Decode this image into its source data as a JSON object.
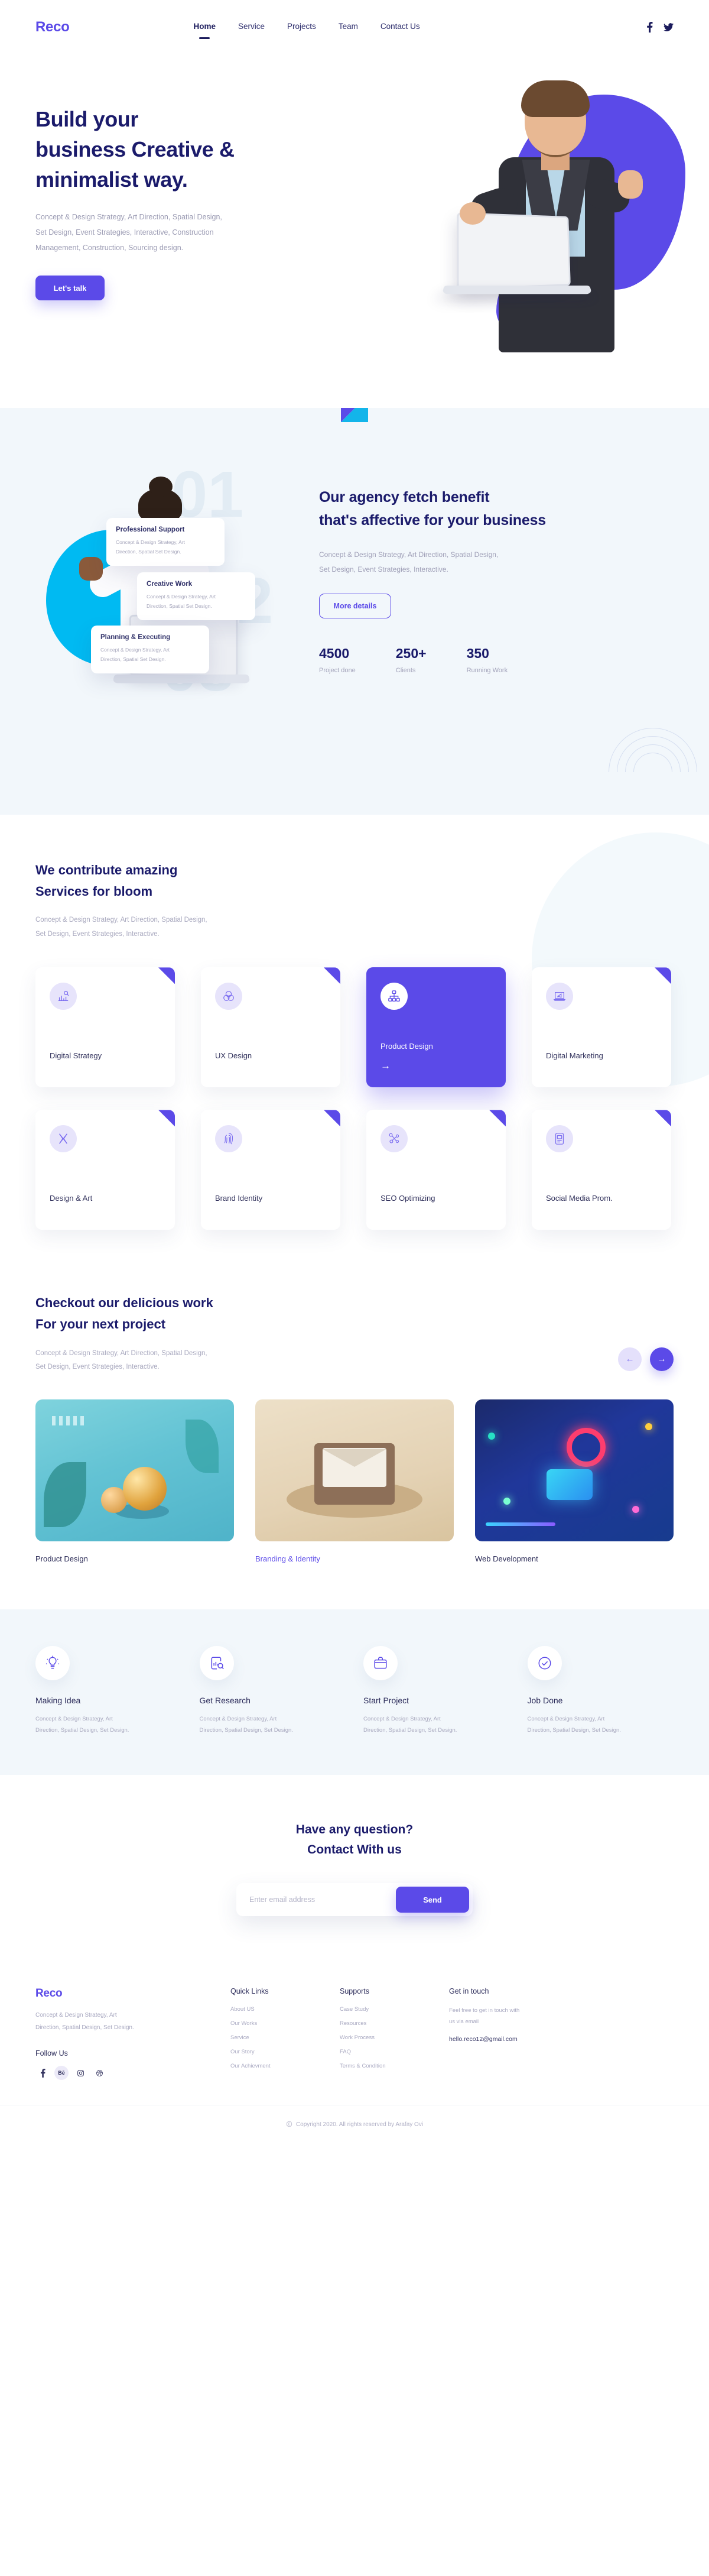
{
  "brand": {
    "name": "Reco",
    "accent": "#5b4ae8",
    "dark": "#1b1b6b",
    "cyan": "#00baf2"
  },
  "header": {
    "nav": [
      {
        "label": "Home",
        "active": true
      },
      {
        "label": "Service",
        "active": false
      },
      {
        "label": "Projects",
        "active": false
      },
      {
        "label": "Team",
        "active": false
      },
      {
        "label": "Contact Us",
        "active": false
      }
    ],
    "social": [
      {
        "name": "facebook-icon",
        "glyph": "f"
      },
      {
        "name": "twitter-icon",
        "glyph": "🐦"
      }
    ]
  },
  "hero": {
    "title_line1": "Build your",
    "title_line2": "business Creative &",
    "title_line3": "minimalist way.",
    "description_line1": "Concept & Design Strategy, Art Direction, Spatial Design,",
    "description_line2": "Set Design, Event Strategies, Interactive, Construction",
    "description_line3": "Management, Construction, Sourcing design.",
    "cta_label": "Let's talk"
  },
  "benefit": {
    "heading_line1": "Our agency fetch benefit",
    "heading_line2": "that's affective for your business",
    "sub_line1": "Concept & Design Strategy, Art Direction, Spatial Design,",
    "sub_line2": "Set Design, Event Strategies, Interactive.",
    "cta_label": "More details",
    "ghost_numbers": [
      "01",
      "02",
      "03"
    ],
    "cards": [
      {
        "title": "Professional Support",
        "line1": "Concept & Design Strategy, Art",
        "line2": "Direction, Spatial Set Design."
      },
      {
        "title": "Creative Work",
        "line1": "Concept & Design Strategy, Art",
        "line2": "Direction, Spatial Set Design."
      },
      {
        "title": "Planning & Executing",
        "line1": "Concept & Design Strategy, Art",
        "line2": "Direction, Spatial Set Design."
      }
    ],
    "stats": [
      {
        "number": "4500",
        "label": "Project done"
      },
      {
        "number": "250+",
        "label": "Clients"
      },
      {
        "number": "350",
        "label": "Running Work"
      }
    ]
  },
  "services": {
    "heading_line1": "We contribute amazing",
    "heading_line2": "Services for bloom",
    "sub_line1": "Concept & Design Strategy, Art Direction, Spatial Design,",
    "sub_line2": "Set Design, Event Strategies, Interactive.",
    "cards": [
      {
        "title": "Digital Strategy",
        "icon": "chart-growth-icon",
        "featured": false
      },
      {
        "title": "UX Design",
        "icon": "venn-circles-icon",
        "featured": false
      },
      {
        "title": "Product Design",
        "icon": "sitemap-icon",
        "featured": true,
        "arrow": "→"
      },
      {
        "title": "Digital Marketing",
        "icon": "megaphone-laptop-icon",
        "featured": false
      },
      {
        "title": "Design & Art",
        "icon": "crossed-ribbons-icon",
        "featured": false
      },
      {
        "title": "Brand Identity",
        "icon": "fingerprint-icon",
        "featured": false
      },
      {
        "title": "SEO Optimizing",
        "icon": "network-nodes-icon",
        "featured": false
      },
      {
        "title": "Social Media Prom.",
        "icon": "mobile-promo-icon",
        "featured": false
      }
    ]
  },
  "work": {
    "heading_line1": "Checkout our delicious work",
    "heading_line2": "For your next project",
    "sub_line1": "Concept & Design Strategy, Art Direction, Spatial Design,",
    "sub_line2": "Set Design, Event Strategies, Interactive.",
    "prev_glyph": "←",
    "next_glyph": "→",
    "items": [
      {
        "label": "Product Design",
        "active": false
      },
      {
        "label": "Branding & Identity",
        "active": true
      },
      {
        "label": "Web Development",
        "active": false
      }
    ]
  },
  "process": {
    "items": [
      {
        "title": "Making Idea",
        "icon": "lightbulb-icon",
        "line1": "Concept & Design Strategy, Art",
        "line2": "Direction, Spatial Design, Set Design."
      },
      {
        "title": "Get Research",
        "icon": "research-chart-icon",
        "line1": "Concept & Design Strategy, Art",
        "line2": "Direction, Spatial Design, Set Design."
      },
      {
        "title": "Start Project",
        "icon": "briefcase-icon",
        "line1": "Concept & Design Strategy, Art",
        "line2": "Direction, Spatial Design, Set Design."
      },
      {
        "title": "Job Done",
        "icon": "check-circle-icon",
        "line1": "Concept & Design Strategy, Art",
        "line2": "Direction, Spatial Design, Set Design."
      }
    ]
  },
  "contact": {
    "heading_line1": "Have any question?",
    "heading_line2": "Contact With us",
    "email_placeholder": "Enter email address",
    "email_value": "",
    "send_label": "Send"
  },
  "footer": {
    "brand": "Reco",
    "about_line1": "Concept & Design Strategy, Art",
    "about_line2": "Direction, Spatial Design, Set Design.",
    "follow_label": "Follow Us",
    "socials": [
      {
        "name": "facebook-icon",
        "glyph": "f",
        "chip": false
      },
      {
        "name": "behance-icon",
        "glyph": "Bē",
        "chip": true
      },
      {
        "name": "instagram-icon",
        "glyph": "▢",
        "chip": false
      },
      {
        "name": "dribbble-icon",
        "glyph": "⊕",
        "chip": false
      }
    ],
    "quick_links": {
      "title": "Quick Links",
      "items": [
        "About US",
        "Our Works",
        "Service",
        "Our Story",
        "Our Achievment"
      ]
    },
    "supports": {
      "title": "Supports",
      "items": [
        "Case Study",
        "Resources",
        "Work Process",
        "FAQ",
        "Terms & Condition"
      ]
    },
    "get_in_touch": {
      "title": "Get in touch",
      "line1": "Feel free to get in touch with",
      "line2": "us via email",
      "email": "hello.reco12@gmail.com"
    },
    "copyright": "Copyright 2020. All rights reserved by Arafay Ovi"
  }
}
